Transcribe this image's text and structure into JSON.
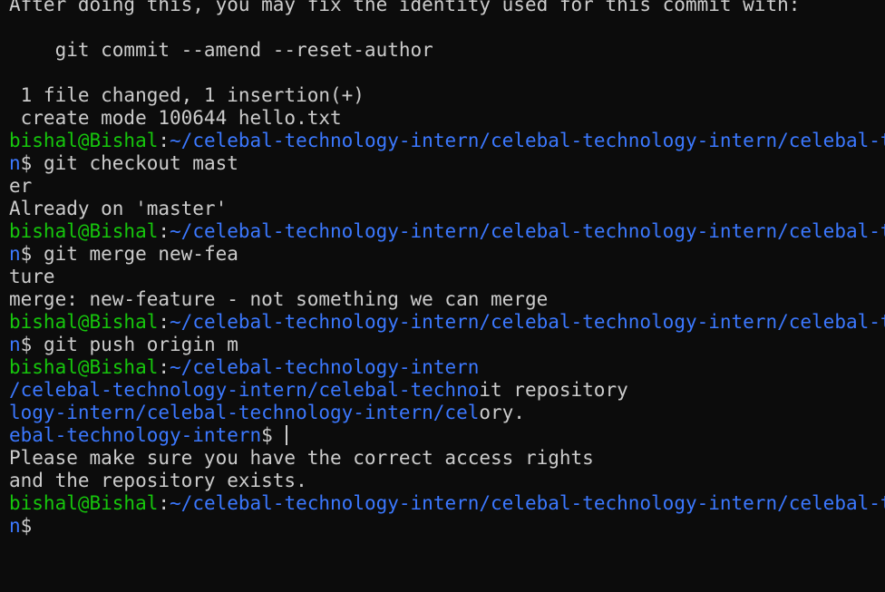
{
  "terminal": {
    "colors": {
      "background": "#0c0c0c",
      "text": "#cccccc",
      "user": "#16c60c",
      "path": "#3b78ff"
    },
    "lines": [
      {
        "segs": [
          {
            "c": "t",
            "text": "After doing this, you may fix the identity used for this commit with:"
          }
        ]
      },
      {
        "segs": [
          {
            "c": "t",
            "text": ""
          }
        ]
      },
      {
        "segs": [
          {
            "c": "t",
            "text": "    git commit --amend --reset-author"
          }
        ]
      },
      {
        "segs": [
          {
            "c": "t",
            "text": ""
          }
        ]
      },
      {
        "segs": [
          {
            "c": "t",
            "text": " 1 file changed, 1 insertion(+)"
          }
        ]
      },
      {
        "segs": [
          {
            "c": "t",
            "text": " create mode 100644 hello.txt"
          }
        ]
      },
      {
        "segs": [
          {
            "c": "u",
            "text": "bishal@Bishal"
          },
          {
            "c": "t",
            "text": ":"
          },
          {
            "c": "p",
            "text": "~/celebal-technology-intern/celebal-technology-intern/celebal-technology-inter"
          }
        ]
      },
      {
        "segs": [
          {
            "c": "p",
            "text": "n"
          },
          {
            "c": "t",
            "text": "$ git checkout mast"
          }
        ]
      },
      {
        "segs": [
          {
            "c": "t",
            "text": "er"
          }
        ]
      },
      {
        "segs": [
          {
            "c": "t",
            "text": "Already on 'master'"
          }
        ]
      },
      {
        "segs": [
          {
            "c": "u",
            "text": "bishal@Bishal"
          },
          {
            "c": "t",
            "text": ":"
          },
          {
            "c": "p",
            "text": "~/celebal-technology-intern/celebal-technology-intern/celebal-technology-inter"
          }
        ]
      },
      {
        "segs": [
          {
            "c": "p",
            "text": "n"
          },
          {
            "c": "t",
            "text": "$ git merge new-fea"
          }
        ]
      },
      {
        "segs": [
          {
            "c": "t",
            "text": "ture"
          }
        ]
      },
      {
        "segs": [
          {
            "c": "t",
            "text": "merge: new-feature - not something we can merge"
          }
        ]
      },
      {
        "segs": [
          {
            "c": "u",
            "text": "bishal@Bishal"
          },
          {
            "c": "t",
            "text": ":"
          },
          {
            "c": "p",
            "text": "~/celebal-technology-intern/celebal-technology-intern/celebal-technology-inter"
          }
        ]
      },
      {
        "segs": [
          {
            "c": "p",
            "text": "n"
          },
          {
            "c": "t",
            "text": "$ git push origin m"
          }
        ]
      },
      {
        "segs": [
          {
            "c": "u",
            "text": "bishal@Bishal"
          },
          {
            "c": "t",
            "text": ":"
          },
          {
            "c": "p",
            "text": "~/celebal-technology-intern"
          }
        ]
      },
      {
        "segs": [
          {
            "c": "p",
            "text": "/celebal-technology-intern/celebal-techno"
          },
          {
            "c": "t",
            "text": "it repository"
          }
        ]
      },
      {
        "segs": [
          {
            "c": "p",
            "text": "logy-intern/celebal-technology-intern/cel"
          },
          {
            "c": "t",
            "text": "ory."
          }
        ]
      },
      {
        "segs": [
          {
            "c": "p",
            "text": "ebal-technology-intern"
          },
          {
            "c": "t",
            "text": "$ "
          }
        ],
        "cursor": true
      },
      {
        "segs": [
          {
            "c": "t",
            "text": "Please make sure you have the correct access rights"
          }
        ]
      },
      {
        "segs": [
          {
            "c": "t",
            "text": "and the repository exists."
          }
        ]
      },
      {
        "segs": [
          {
            "c": "u",
            "text": "bishal@Bishal"
          },
          {
            "c": "t",
            "text": ":"
          },
          {
            "c": "p",
            "text": "~/celebal-technology-intern/celebal-technology-intern/celebal-technology-inter"
          }
        ]
      },
      {
        "segs": [
          {
            "c": "p",
            "text": "n"
          },
          {
            "c": "t",
            "text": "$"
          }
        ]
      }
    ]
  }
}
